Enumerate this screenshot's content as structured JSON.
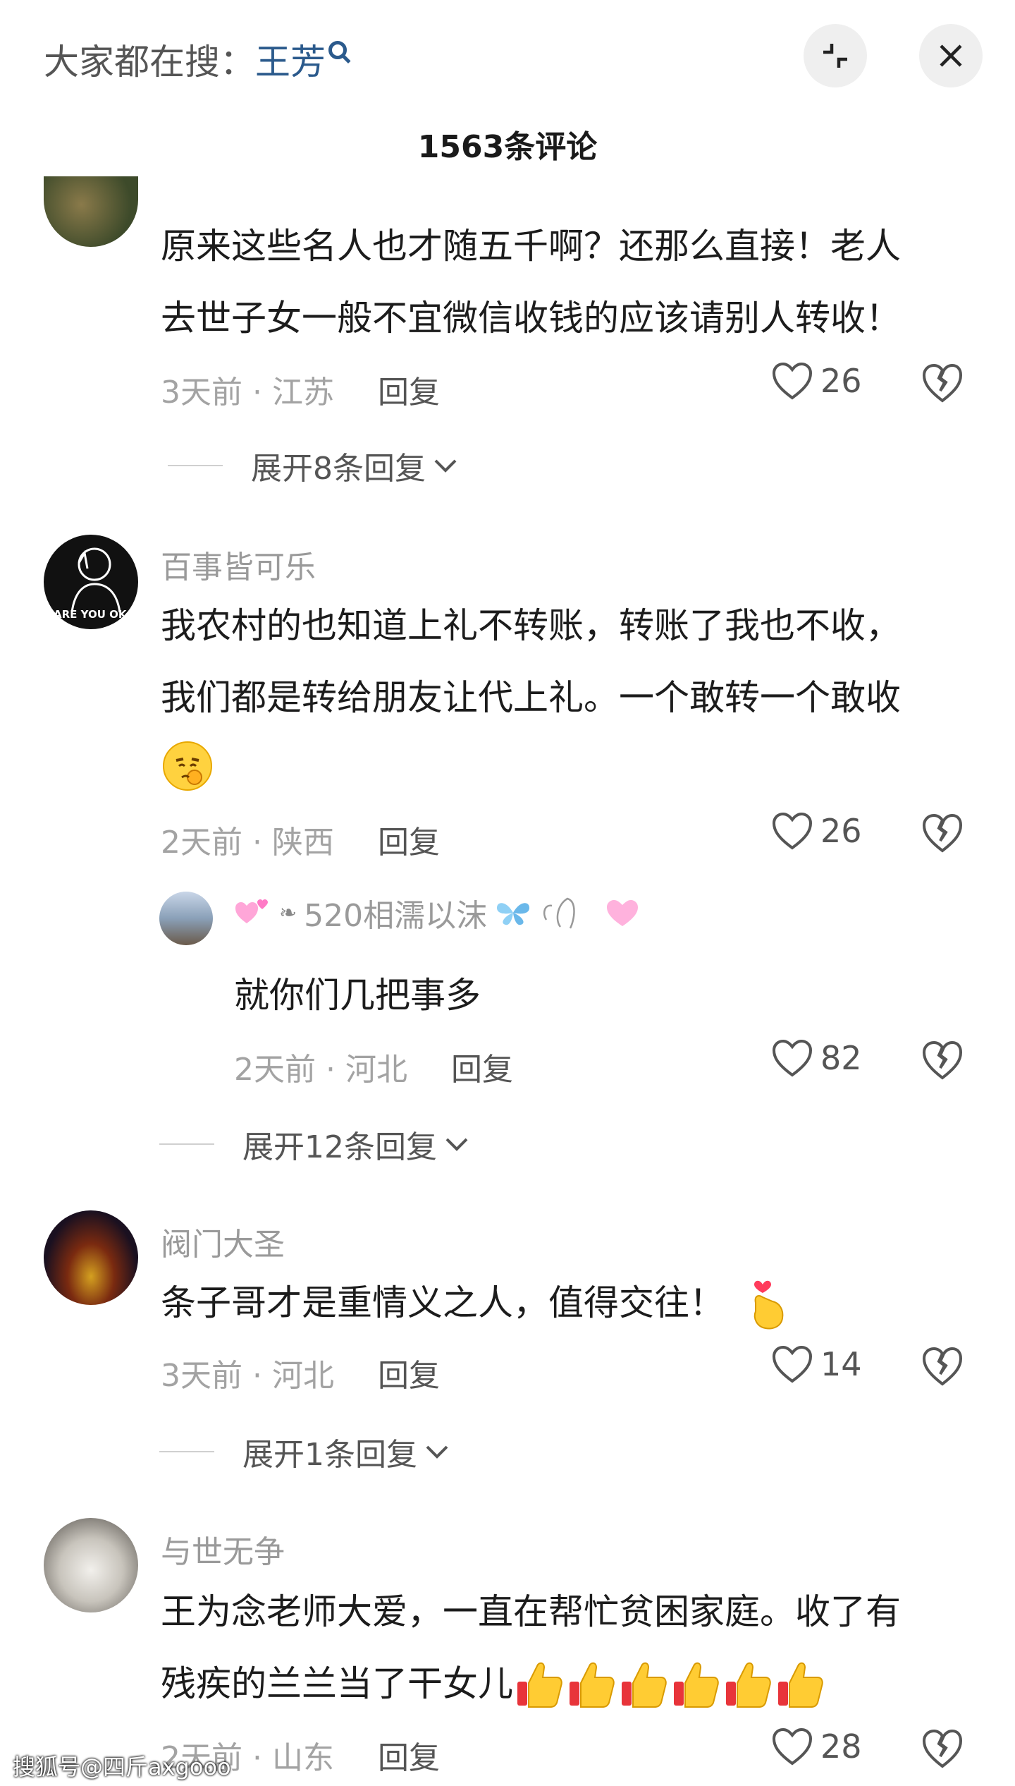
{
  "header": {
    "search_prefix": "大家都在搜：",
    "search_keyword": "王芳",
    "comment_count": "1563条评论"
  },
  "comments": [
    {
      "text_lines": [
        "原来这些名人也才随五千啊？还那么直接！老人",
        "去世子女一般不宜微信收钱的应该请别人转收！"
      ],
      "meta": "3天前 · 江苏",
      "reply": "回复",
      "likes": "26",
      "expand": "展开8条回复"
    },
    {
      "username": "百事皆可乐",
      "avatar_caption": "ARE YOU OK",
      "text_lines": [
        "我农村的也知道上礼不转账，转账了我也不收，",
        "我们都是转给朋友让代上礼。一个敢转一个敢收"
      ],
      "meta": "2天前 · 陕西",
      "reply": "回复",
      "likes": "26",
      "sub_reply": {
        "username": "520相濡以沫",
        "text": "就你们几把事多",
        "meta": "2天前 · 河北",
        "reply": "回复",
        "likes": "82"
      },
      "expand": "展开12条回复"
    },
    {
      "username": "阀门大圣",
      "text_lines": [
        "条子哥才是重情义之人，值得交往！"
      ],
      "meta": "3天前 · 河北",
      "reply": "回复",
      "likes": "14",
      "expand": "展开1条回复"
    },
    {
      "username": "与世无争",
      "text_lines": [
        "王为念老师大爱，一直在帮忙贫困家庭。收了有",
        "残疾的兰兰当了干女儿"
      ],
      "meta": "2天前 · 山东",
      "reply": "回复",
      "likes": "28"
    }
  ],
  "watermark": "搜狐号@四斤axgooo",
  "colors": {
    "keyword": "#2b5a8c",
    "meta": "#a3a3a3",
    "username": "#9a9a9a"
  }
}
